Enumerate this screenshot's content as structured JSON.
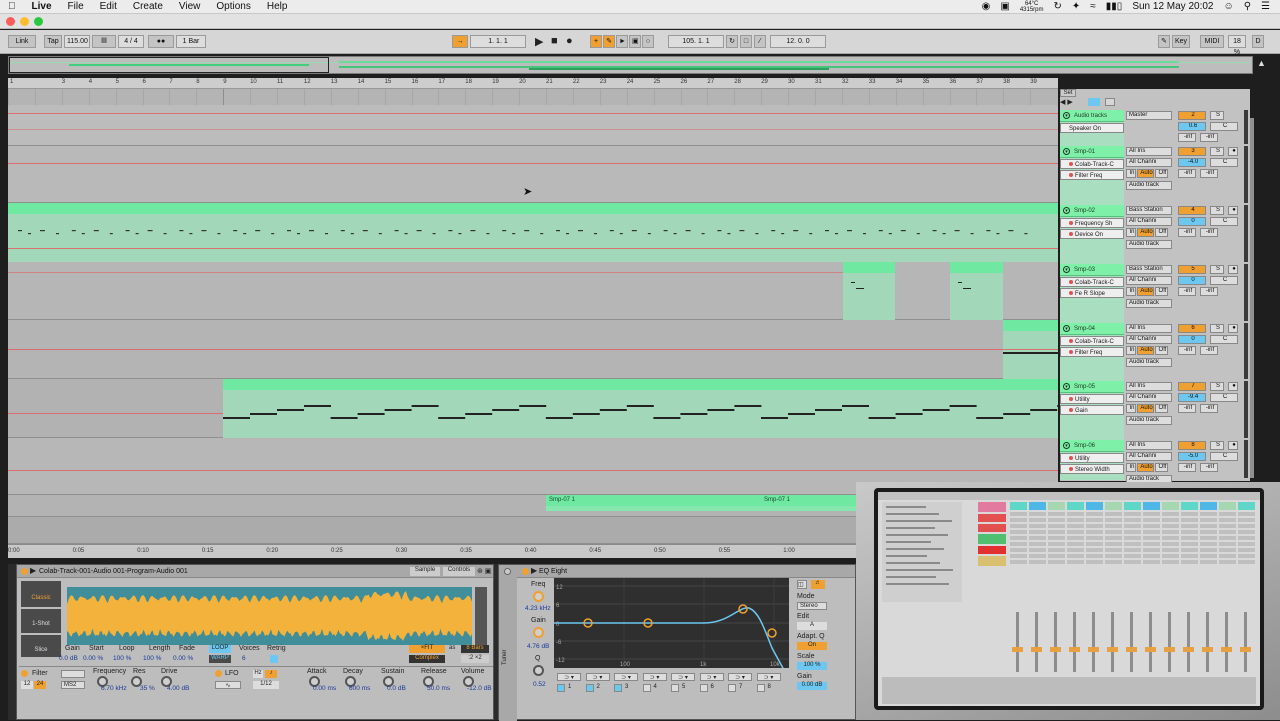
{
  "menubar": {
    "app": "Live",
    "items": [
      "File",
      "Edit",
      "Create",
      "View",
      "Options",
      "Help"
    ],
    "weather": "64°C",
    "status_rpm": "4315rpm",
    "clock": "Sun 12 May  20:02"
  },
  "control_bar": {
    "link": "Link",
    "tap": "Tap",
    "tempo": "115.00",
    "signature": "4 / 4",
    "quantize": "1 Bar",
    "position": "1.   1.   1",
    "loop_start": "105.   1.   1",
    "loop_length": "12.   0.   0",
    "key": "Key",
    "midi": "MIDI",
    "cpu": "18 %",
    "d": "D"
  },
  "ruler": {
    "bars": [
      "1",
      "3",
      "4",
      "5",
      "6",
      "7",
      "8",
      "9",
      "10",
      "11",
      "12",
      "13",
      "14",
      "15",
      "16",
      "17",
      "18",
      "19",
      "20",
      "21",
      "22",
      "23",
      "24",
      "25",
      "26",
      "27",
      "28",
      "29",
      "30",
      "31",
      "32",
      "33",
      "34",
      "35",
      "36",
      "37",
      "38",
      "39"
    ],
    "times": [
      "0:00",
      "0:05",
      "0:10",
      "0:15",
      "0:20",
      "0:25",
      "0:30",
      "0:35",
      "0:40",
      "0:45",
      "0:50",
      "0:55",
      "1:00"
    ]
  },
  "arrangement": {
    "clip_smp07a": "Smp-07 1",
    "clip_smp07b": "Smp-07 1"
  },
  "mixer": {
    "set_label": "Set",
    "tracks": [
      {
        "name": "Audio tracks",
        "sub1": "Speaker On",
        "sub2": "",
        "route1": "Master",
        "route2": "",
        "number": "2",
        "vol": "0.6",
        "pan": "C",
        "meter_a": "-inf",
        "meter_b": "-inf"
      },
      {
        "name": "Smp-01",
        "sub1": "Colab-Track-C",
        "sub2": "Filter Freq",
        "route1": "All Ins",
        "route2": "All Channi",
        "number": "3",
        "vol": "-4.0",
        "pan": "C",
        "meter_a": "-inf",
        "meter_b": "-inf",
        "audio_to": "Audio track"
      },
      {
        "name": "Smp-02",
        "sub1": "Frequency Sh",
        "sub2": "Device On",
        "route1": "Bass Station",
        "route2": "All Channi",
        "number": "4",
        "vol": "0",
        "pan": "C",
        "meter_a": "-inf",
        "meter_b": "-inf",
        "audio_to": "Audio track"
      },
      {
        "name": "Smp-03",
        "sub1": "Colab-Track-C",
        "sub2": "Fe R Slope",
        "route1": "Bass Station",
        "route2": "All Channi",
        "number": "5",
        "vol": "0",
        "pan": "C",
        "meter_a": "-inf",
        "meter_b": "-inf",
        "audio_to": "Audio track"
      },
      {
        "name": "Smp-04",
        "sub1": "Colab-Track-C",
        "sub2": "Filter Freq",
        "route1": "All Ins",
        "route2": "All Channi",
        "number": "6",
        "vol": "0",
        "pan": "C",
        "meter_a": "-inf",
        "meter_b": "-inf",
        "audio_to": "Audio track"
      },
      {
        "name": "Smp-05",
        "sub1": "Utility",
        "sub2": "Gain",
        "route1": "All Ins",
        "route2": "All Channi",
        "number": "7",
        "vol": "-9.4",
        "pan": "C",
        "meter_a": "-inf",
        "meter_b": "-inf",
        "audio_to": "Audio track"
      },
      {
        "name": "Smp-06",
        "sub1": "Utility",
        "sub2": "Stereo Width",
        "route1": "All Ins",
        "route2": "All Channi",
        "number": "8",
        "vol": "-5.0",
        "pan": "C",
        "meter_a": "-inf",
        "meter_b": "-inf",
        "audio_to": "Audio track"
      }
    ],
    "in_label": "In",
    "auto_label": "Auto",
    "off_label": "Off",
    "s_label": "S"
  },
  "simpler": {
    "title": "Colab-Track-001-Audio 001-Program-Audio 001",
    "tab_sample": "Sample",
    "tab_controls": "Controls",
    "mode_classic": "Classic",
    "mode_1shot": "1-Shot",
    "mode_slice": "Slice",
    "params": [
      {
        "label": "Gain",
        "value": "0.0 dB"
      },
      {
        "label": "Start",
        "value": "0.00 %"
      },
      {
        "label": "Loop",
        "value": "100 %"
      },
      {
        "label": "Length",
        "value": "100 %"
      },
      {
        "label": "Fade",
        "value": "0.00 %"
      }
    ],
    "loop_btn": "LOOP",
    "warp_btn": "WARP",
    "voices_label": "Voices",
    "voices_value": "6",
    "retrig_label": "Retrig",
    "warp_mode": "Complex",
    "as_label": "as",
    "bars_value": "8 Bars",
    "warp_extra": "×FIT",
    "filter_label": "Filter",
    "filter_type": "MS2",
    "filter_slope_a": "12",
    "filter_slope_b": "24",
    "freq_label": "Frequency",
    "freq_value": "6.70 kHz",
    "res_label": "Res",
    "res_value": "35 %",
    "drive_label": "Drive",
    "drive_value": "4.00 dB",
    "lfo_label": "LFO",
    "lfo_hz": "Hz",
    "lfo_rate": "1/12",
    "attack_label": "Attack",
    "attack_value": "0.00 ms",
    "decay_label": "Decay",
    "decay_value": "600 ms",
    "sustain_label": "Sustain",
    "sustain_value": "0.0 dB",
    "release_label": "Release",
    "release_value": "50.0 ms",
    "volume_label": "Volume",
    "volume_value": "-12.0 dB"
  },
  "eq_eight": {
    "title": "EQ Eight",
    "freq_label": "Freq",
    "freq_value": "4.23 kHz",
    "gain_label": "Gain",
    "gain_value": "4.76 dB",
    "q_label": "Q",
    "q_value": "0.52",
    "mode_label": "Mode",
    "mode_value": "Stereo",
    "edit_label": "Edit",
    "edit_value": "A",
    "adaptq_label": "Adapt. Q",
    "adaptq_value": "On",
    "scale_label": "Scale",
    "scale_value": "100 %",
    "outgain_label": "Gain",
    "outgain_value": "0.00 dB",
    "db_ticks": [
      "12",
      "6",
      "0",
      "-6",
      "-12"
    ],
    "freq_ticks": [
      "100",
      "1k",
      "10k"
    ],
    "bands": [
      "1",
      "2",
      "3",
      "4",
      "5",
      "6",
      "7",
      "8"
    ],
    "tuner_label": "Tuner"
  }
}
